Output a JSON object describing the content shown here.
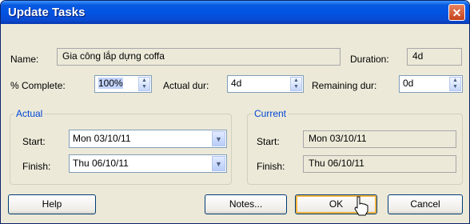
{
  "window": {
    "title": "Update Tasks",
    "close_glyph": "✕"
  },
  "task": {
    "name_label": "Name:",
    "name_value": "Gia công lắp dựng coffa",
    "duration_label": "Duration:",
    "duration_value": "4d"
  },
  "progress": {
    "pct_label": "% Complete:",
    "pct_value": "100%",
    "actual_dur_label": "Actual dur:",
    "actual_dur_value": "4d",
    "remaining_dur_label": "Remaining dur:",
    "remaining_dur_value": "0d"
  },
  "actual": {
    "legend": "Actual",
    "start_label": "Start:",
    "start_value": "Mon 03/10/11",
    "finish_label": "Finish:",
    "finish_value": "Thu 06/10/11"
  },
  "current": {
    "legend": "Current",
    "start_label": "Start:",
    "start_value": "Mon 03/10/11",
    "finish_label": "Finish:",
    "finish_value": "Thu 06/10/11"
  },
  "buttons": {
    "help": "Help",
    "notes": "Notes...",
    "ok": "OK",
    "cancel": "Cancel"
  },
  "colors": {
    "title_bar": "#0054e3",
    "dialog_bg": "#ece9d8",
    "group_legend": "#0046d5"
  }
}
